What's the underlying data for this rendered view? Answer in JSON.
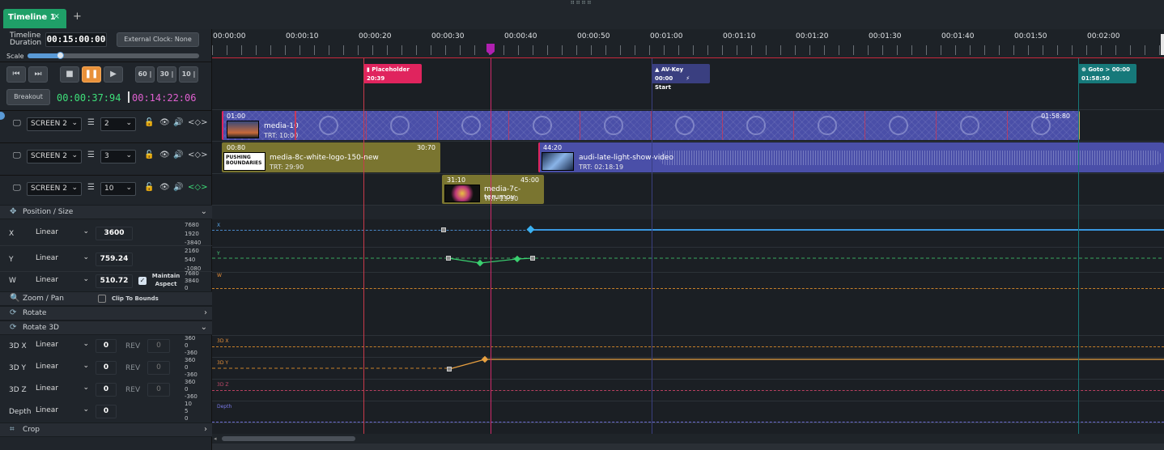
{
  "tab": {
    "title": "Timeline 1",
    "close": "×",
    "add": "+"
  },
  "handle": "⠿⠿⠿⠿",
  "header": {
    "duration_label": "Timeline Duration",
    "duration_value": "00:15:00:00",
    "external_clock": "External Clock: None",
    "scale_label": "Scale",
    "scale_fraction": 0.2
  },
  "transport": {
    "step_60": "60 |",
    "step_30": "30 |",
    "step_10": "10 |",
    "breakout": "Breakout",
    "current_time": "00:00:37:94",
    "remaining_time": "00:14:22:06"
  },
  "layers": [
    {
      "screen": "SCREEN 2",
      "layer": "2"
    },
    {
      "screen": "SCREEN 2",
      "layer": "3"
    },
    {
      "screen": "SCREEN 2",
      "layer": "10"
    }
  ],
  "sections": {
    "position_size": "Position / Size",
    "zoom_pan": "Zoom / Pan",
    "clip_to_bounds": "Clip To Bounds",
    "rotate": "Rotate",
    "rotate3d": "Rotate 3D",
    "crop": "Crop"
  },
  "properties": {
    "x": {
      "label": "X",
      "interp": "Linear",
      "value": "3600",
      "scale": [
        "7680",
        "1920",
        "-3840"
      ]
    },
    "y": {
      "label": "Y",
      "interp": "Linear",
      "value": "759.24",
      "scale": [
        "2160",
        "540",
        "-1080"
      ]
    },
    "w": {
      "label": "W",
      "interp": "Linear",
      "value": "510.72",
      "maintain": "Maintain Aspect",
      "scale": [
        "7680",
        "3840",
        "0"
      ]
    },
    "r3x": {
      "label": "3D X",
      "interp": "Linear",
      "value": "0",
      "rev": "REV",
      "rev_value": "0",
      "scale": [
        "360",
        "0",
        "-360"
      ]
    },
    "r3y": {
      "label": "3D Y",
      "interp": "Linear",
      "value": "0",
      "rev": "REV",
      "rev_value": "0",
      "scale": [
        "360",
        "0",
        "-360"
      ]
    },
    "r3z": {
      "label": "3D Z",
      "interp": "Linear",
      "value": "0",
      "rev": "REV",
      "rev_value": "0",
      "scale": [
        "360",
        "0",
        "-360"
      ]
    },
    "depth": {
      "label": "Depth",
      "interp": "Linear",
      "value": "0",
      "scale": [
        "10",
        "5",
        "0"
      ]
    }
  },
  "ruler": [
    "00:00:00",
    "00:00:10",
    "00:00:20",
    "00:00:30",
    "00:00:40",
    "00:00:50",
    "00:01:00",
    "00:01:10",
    "00:01:20",
    "00:01:30",
    "00:01:40",
    "00:01:50",
    "00:02:00"
  ],
  "markers": [
    {
      "title": "Placeholder",
      "time": "20:39",
      "color": "#e0245e"
    },
    {
      "title": "AV-Key",
      "time": "00:00",
      "extra": "Start",
      "color": "#3a3f80"
    },
    {
      "title": "Goto > 00:00",
      "time": "01:58:50",
      "color": "#16797a"
    }
  ],
  "clips": {
    "c1": {
      "name": "media-10",
      "start": "01:00",
      "end": "01:58:80",
      "trt": "TRT: 10:00"
    },
    "c2": {
      "name": "media-8c-white-logo-150-new",
      "start": "00:80",
      "end": "30:70",
      "trt": "TRT: 29:90",
      "thumb_text": "PUSHING BOUNDARIES"
    },
    "c3": {
      "name": "audi-late-light-show-video",
      "start": "44:20",
      "trt": "TRT: 02:18:19"
    },
    "c4": {
      "name": "media-7c-terumov",
      "start": "31:10",
      "end": "45:00",
      "trt": "TRT: 13:90"
    }
  },
  "curve_labels": {
    "x": "X",
    "y": "Y",
    "w": "W",
    "r3x": "3D X",
    "r3y": "3D Y",
    "r3z": "3D Z",
    "depth": "Depth"
  },
  "colors": {
    "accent": "#1fa068",
    "playhead": "#b020b0",
    "orange": "#e89a3a",
    "blue_clip": "#4a4fa8",
    "olive_clip": "#7a7530"
  }
}
